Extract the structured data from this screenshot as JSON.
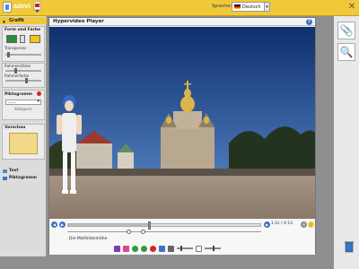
{
  "app": {
    "title": "ADIVI",
    "logo_icon": "heraldic-logo-icon"
  },
  "language": {
    "label": "Sprache:",
    "value": "Deutsch"
  },
  "left_panel": {
    "header": "Grafik",
    "form_farbe": "Form und Farbe",
    "transparenz": "Transparenz",
    "rahmenstaerke": "Rahmenstärke",
    "rahmenfarbe": "Rahmenfarbe",
    "piktogramm": "Piktogramm",
    "pikto_value": "------",
    "kategorie": "Kategorie",
    "vorschau": "Vorschau",
    "text_link": "Text",
    "pikto_link": "Piktogramm",
    "colors": {
      "fill": "#f5c518",
      "shape": "#2e8b3a",
      "preview": "#f2d98a"
    }
  },
  "player": {
    "title": "Hypervideo Player",
    "time": "1:2s / 4:14",
    "caption": "Die Mathildenhöhe",
    "progress_fraction": 0.42
  },
  "dock": {
    "btn1_icon": "paperclip-icon",
    "btn2_icon": "search-icon"
  },
  "colors": {
    "accent": "#f0c93a",
    "blue": "#3a74c8",
    "sky": "#1f4a8a"
  }
}
